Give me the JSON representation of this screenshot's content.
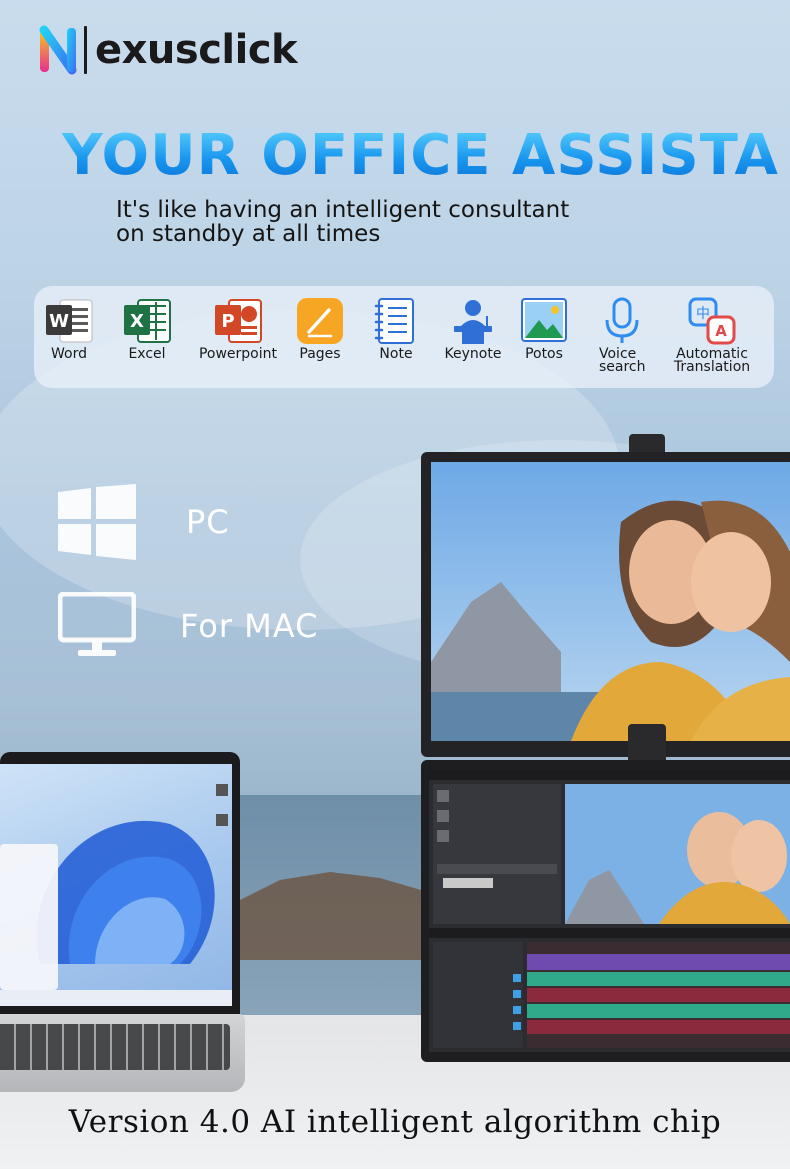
{
  "brand": {
    "name": "exusclick"
  },
  "headline": "YOUR OFFICE ASSISTANT",
  "subline": {
    "line1": "It's like having an intelligent consultant",
    "line2": "on standby at all times"
  },
  "apps": [
    {
      "label": "Word",
      "icon": "word-icon"
    },
    {
      "label": "Excel",
      "icon": "excel-icon"
    },
    {
      "label": "Powerpoint",
      "icon": "powerpoint-icon"
    },
    {
      "label": "Pages",
      "icon": "pages-icon"
    },
    {
      "label": "Note",
      "icon": "note-icon"
    },
    {
      "label": "Keynote",
      "icon": "keynote-icon"
    },
    {
      "label": "Potos",
      "icon": "photos-icon"
    },
    {
      "label": "Voice\nsearch",
      "icon": "microphone-icon"
    },
    {
      "label": "Automatic\nTranslation",
      "icon": "translation-icon"
    }
  ],
  "os": {
    "pc": {
      "label": "PC",
      "icon": "windows-icon"
    },
    "mac": {
      "label": "For MAC",
      "icon": "monitor-icon"
    }
  },
  "footer": "Version 4.0 AI intelligent algorithm chip",
  "colors": {
    "headline_top": "#5fd4ff",
    "headline_bottom": "#0a6fd6",
    "word": "#2b579a",
    "excel": "#1f7244",
    "powerpoint": "#d24726",
    "pages": "#f6a623",
    "accent_blue": "#1e8ef0"
  }
}
